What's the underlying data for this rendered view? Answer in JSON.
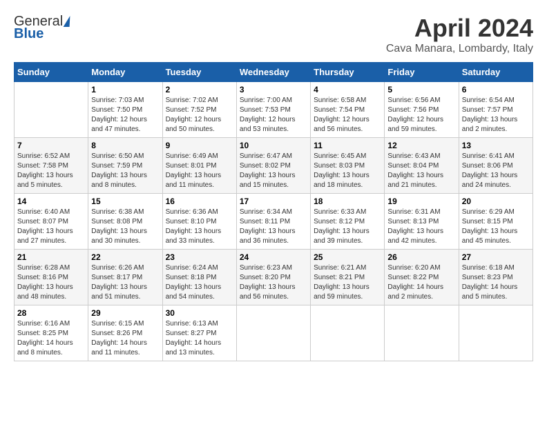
{
  "logo": {
    "general": "General",
    "blue": "Blue"
  },
  "title": "April 2024",
  "subtitle": "Cava Manara, Lombardy, Italy",
  "headers": [
    "Sunday",
    "Monday",
    "Tuesday",
    "Wednesday",
    "Thursday",
    "Friday",
    "Saturday"
  ],
  "weeks": [
    [
      {
        "day": "",
        "info": ""
      },
      {
        "day": "1",
        "info": "Sunrise: 7:03 AM\nSunset: 7:50 PM\nDaylight: 12 hours\nand 47 minutes."
      },
      {
        "day": "2",
        "info": "Sunrise: 7:02 AM\nSunset: 7:52 PM\nDaylight: 12 hours\nand 50 minutes."
      },
      {
        "day": "3",
        "info": "Sunrise: 7:00 AM\nSunset: 7:53 PM\nDaylight: 12 hours\nand 53 minutes."
      },
      {
        "day": "4",
        "info": "Sunrise: 6:58 AM\nSunset: 7:54 PM\nDaylight: 12 hours\nand 56 minutes."
      },
      {
        "day": "5",
        "info": "Sunrise: 6:56 AM\nSunset: 7:56 PM\nDaylight: 12 hours\nand 59 minutes."
      },
      {
        "day": "6",
        "info": "Sunrise: 6:54 AM\nSunset: 7:57 PM\nDaylight: 13 hours\nand 2 minutes."
      }
    ],
    [
      {
        "day": "7",
        "info": "Sunrise: 6:52 AM\nSunset: 7:58 PM\nDaylight: 13 hours\nand 5 minutes."
      },
      {
        "day": "8",
        "info": "Sunrise: 6:50 AM\nSunset: 7:59 PM\nDaylight: 13 hours\nand 8 minutes."
      },
      {
        "day": "9",
        "info": "Sunrise: 6:49 AM\nSunset: 8:01 PM\nDaylight: 13 hours\nand 11 minutes."
      },
      {
        "day": "10",
        "info": "Sunrise: 6:47 AM\nSunset: 8:02 PM\nDaylight: 13 hours\nand 15 minutes."
      },
      {
        "day": "11",
        "info": "Sunrise: 6:45 AM\nSunset: 8:03 PM\nDaylight: 13 hours\nand 18 minutes."
      },
      {
        "day": "12",
        "info": "Sunrise: 6:43 AM\nSunset: 8:04 PM\nDaylight: 13 hours\nand 21 minutes."
      },
      {
        "day": "13",
        "info": "Sunrise: 6:41 AM\nSunset: 8:06 PM\nDaylight: 13 hours\nand 24 minutes."
      }
    ],
    [
      {
        "day": "14",
        "info": "Sunrise: 6:40 AM\nSunset: 8:07 PM\nDaylight: 13 hours\nand 27 minutes."
      },
      {
        "day": "15",
        "info": "Sunrise: 6:38 AM\nSunset: 8:08 PM\nDaylight: 13 hours\nand 30 minutes."
      },
      {
        "day": "16",
        "info": "Sunrise: 6:36 AM\nSunset: 8:10 PM\nDaylight: 13 hours\nand 33 minutes."
      },
      {
        "day": "17",
        "info": "Sunrise: 6:34 AM\nSunset: 8:11 PM\nDaylight: 13 hours\nand 36 minutes."
      },
      {
        "day": "18",
        "info": "Sunrise: 6:33 AM\nSunset: 8:12 PM\nDaylight: 13 hours\nand 39 minutes."
      },
      {
        "day": "19",
        "info": "Sunrise: 6:31 AM\nSunset: 8:13 PM\nDaylight: 13 hours\nand 42 minutes."
      },
      {
        "day": "20",
        "info": "Sunrise: 6:29 AM\nSunset: 8:15 PM\nDaylight: 13 hours\nand 45 minutes."
      }
    ],
    [
      {
        "day": "21",
        "info": "Sunrise: 6:28 AM\nSunset: 8:16 PM\nDaylight: 13 hours\nand 48 minutes."
      },
      {
        "day": "22",
        "info": "Sunrise: 6:26 AM\nSunset: 8:17 PM\nDaylight: 13 hours\nand 51 minutes."
      },
      {
        "day": "23",
        "info": "Sunrise: 6:24 AM\nSunset: 8:18 PM\nDaylight: 13 hours\nand 54 minutes."
      },
      {
        "day": "24",
        "info": "Sunrise: 6:23 AM\nSunset: 8:20 PM\nDaylight: 13 hours\nand 56 minutes."
      },
      {
        "day": "25",
        "info": "Sunrise: 6:21 AM\nSunset: 8:21 PM\nDaylight: 13 hours\nand 59 minutes."
      },
      {
        "day": "26",
        "info": "Sunrise: 6:20 AM\nSunset: 8:22 PM\nDaylight: 14 hours\nand 2 minutes."
      },
      {
        "day": "27",
        "info": "Sunrise: 6:18 AM\nSunset: 8:23 PM\nDaylight: 14 hours\nand 5 minutes."
      }
    ],
    [
      {
        "day": "28",
        "info": "Sunrise: 6:16 AM\nSunset: 8:25 PM\nDaylight: 14 hours\nand 8 minutes."
      },
      {
        "day": "29",
        "info": "Sunrise: 6:15 AM\nSunset: 8:26 PM\nDaylight: 14 hours\nand 11 minutes."
      },
      {
        "day": "30",
        "info": "Sunrise: 6:13 AM\nSunset: 8:27 PM\nDaylight: 14 hours\nand 13 minutes."
      },
      {
        "day": "",
        "info": ""
      },
      {
        "day": "",
        "info": ""
      },
      {
        "day": "",
        "info": ""
      },
      {
        "day": "",
        "info": ""
      }
    ]
  ]
}
